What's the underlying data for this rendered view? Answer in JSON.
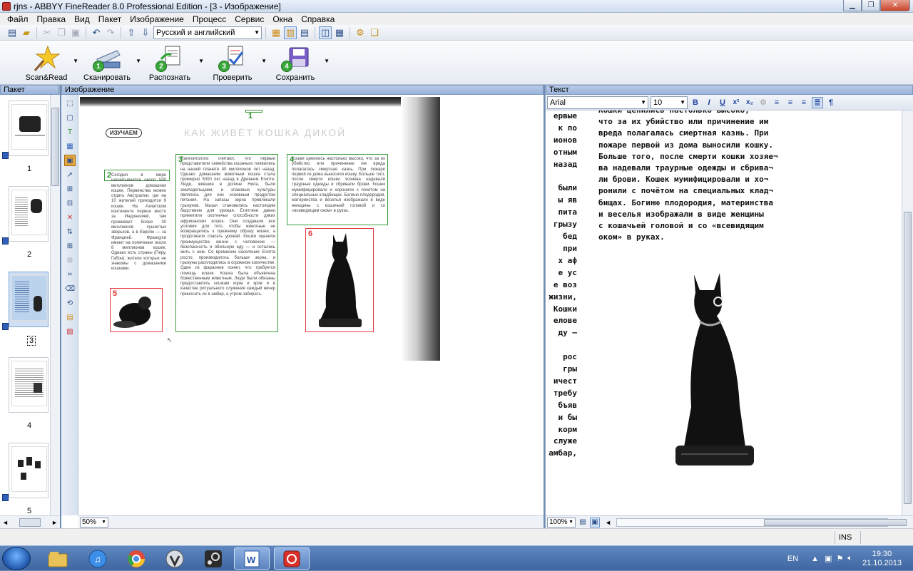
{
  "window": {
    "title": "rjns - ABBYY FineReader 8.0 Professional Edition - [3 - Изображение]"
  },
  "menu": [
    "Файл",
    "Правка",
    "Вид",
    "Пакет",
    "Изображение",
    "Процесс",
    "Сервис",
    "Окна",
    "Справка"
  ],
  "toolbar1": {
    "language": "Русский и английский"
  },
  "toolbar2": {
    "buttons": [
      {
        "label": "Scan&Read",
        "num": ""
      },
      {
        "label": "Сканировать",
        "num": "1"
      },
      {
        "label": "Распознать",
        "num": "2"
      },
      {
        "label": "Проверить",
        "num": "3"
      },
      {
        "label": "Сохранить",
        "num": "4"
      }
    ]
  },
  "panes": {
    "batch": "Пакет",
    "image": "Изображение",
    "text": "Текст"
  },
  "batch_pages": [
    "1",
    "2",
    "3",
    "4",
    "5"
  ],
  "image_pane": {
    "zoom": "50%",
    "scan": {
      "header_logo": "ИЗУЧАЕМ",
      "header_title": "КАК ЖИВЁТ КОШКА ДИКОЙ",
      "block_numbers": [
        "1",
        "2",
        "3",
        "4",
        "5",
        "6"
      ],
      "col1_text": "Сегодня в мире насчитывается около 500 миллионов домашних кошек. Первенства можно отдать Австралии, где на 10 жителей приходится 9 кошек. На Азиатском континенте первое место за Индонезией, там проживает более 30 миллионов пушистых зверьков, а в Европе — за Францией. Францухи имеют на попечении около 8 миллионов кошек. Однако есть страны (Перу, Габон), жители которых не знакомы с домашними кошками.",
      "col2_text": "Палеонтологи считают, что первые представители семейства кошачьих появились на нашей планете 40 миллионов лет назад. Однако домашним животным кошка стала примерно 5000 лет назад в Древнем Египте. Люди, жившие в долине Нила, были земледельцами, и злаковые культуры являлись для них основным продуктом питания. На запасы зерна привлекали грызунов. Мыши становились настоящим бедствием для урожая. Египтяне давно приметили охотничьи способности диких африканских кошек. Они создавали все условия для того, чтобы животные не возвращались к прежнему образу жизни, а продолжали спасать урожай. Кошки оценили преимущества жизни с человеком — безопасность и обильную еду — и остались жить с ним. Со временем население Египта росло, производилось больше зерна, и грызуны расплодились в огромном количестве. Один из фараонов понял, что требуется помощь кошек. Кошка была объявлена божественным животным. Люди были обязаны предоставлять кошкам корм и кров и в качестве ритуального служения каждый вечер приносить их в амбар, а утром забирать.",
      "col3_text": "Кошки ценились настолько высоко, что за их убийство или причинение им вреда полагалась смертная казнь. При пожаре первой из дома выносили кошку. Больше того, после смерти кошки хозяева надевали траурные одежды и сбривали брови. Кошек мумифицировали и хоронили с почётом на специальных кладбищах. Богиню плодородия, материнства и веселья изображали в виде женщины с кошачьей головой и со «всевидящим оком» в руках."
    }
  },
  "text_pane": {
    "font": "Arial",
    "size": "10",
    "zoom": "100%",
    "left_fragments": [
      "ервые",
      "к по",
      "ионов",
      "отным",
      "назад",
      "",
      "были",
      "ы яв",
      "пита",
      "грызу",
      "бед",
      "при",
      "х аф",
      "е ус",
      "е воз",
      "жизни,",
      "Кошки",
      "елове",
      "ду —",
      "",
      "рос",
      "гры",
      "ичест",
      "требу",
      "бъяв",
      "и бы",
      "корм",
      "служе",
      "амбар,"
    ],
    "paragraph": "Кошки ценились настолько высоко,\nчто за их убийство или причинение им\nвреда полагалась смертная казнь. При\nпожаре первой из дома выносили кошку.\nБольше того, после смерти кошки хозяе¬\nва надевали траурные одежды и сбрива¬\nли брови. Кошек мумифицировали и хо¬\nронили с почётом на специальных клад¬\nбищах. Богиню плодородия, материнства\nи веселья изображали в виде женщины\nс кошачьей головой и со «всевидящим\nоком» в руках."
  },
  "status": {
    "ins": "INS"
  },
  "taskbar": {
    "lang": "EN",
    "time": "19:30",
    "date": "21.10.2013"
  }
}
